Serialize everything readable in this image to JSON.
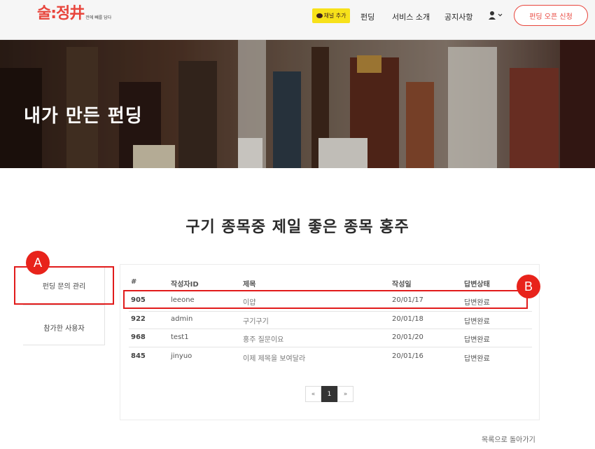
{
  "header": {
    "logo_main": "술:정井",
    "logo_sub": "전에 빼를 담다",
    "kakao_label": "채널 추가",
    "nav": [
      "펀딩",
      "서비스 소개",
      "공지사항"
    ],
    "open_button": "펀딩 오픈 신청"
  },
  "banner": {
    "title": "내가 만든 펀딩"
  },
  "page_title": "구기 종목중 제일 좋은 종목 홍주",
  "side_menu": {
    "items": [
      "펀딩 문의 관리",
      "참가한 사용자"
    ]
  },
  "table": {
    "headers": [
      "#",
      "작성자ID",
      "제목",
      "작성일",
      "답변상태"
    ],
    "rows": [
      {
        "num": "905",
        "author": "leeone",
        "title": "이얍",
        "date": "20/01/17",
        "status": "답변완료"
      },
      {
        "num": "922",
        "author": "admin",
        "title": "구기구기",
        "date": "20/01/18",
        "status": "답변완료"
      },
      {
        "num": "968",
        "author": "test1",
        "title": "홍주 질문이요",
        "date": "20/01/20",
        "status": "답변완료"
      },
      {
        "num": "845",
        "author": "jinyuo",
        "title": "이제 제목을 보여달라",
        "date": "20/01/16",
        "status": "답변완료"
      }
    ]
  },
  "pagination": {
    "prev": "«",
    "current": "1",
    "next": "»"
  },
  "back_link": "목록으로 돌아가기",
  "annotations": {
    "a": "A",
    "b": "B"
  },
  "colors": {
    "brand": "#e8453c",
    "annotation": "#e11b1b",
    "kakao": "#f7e11a"
  }
}
